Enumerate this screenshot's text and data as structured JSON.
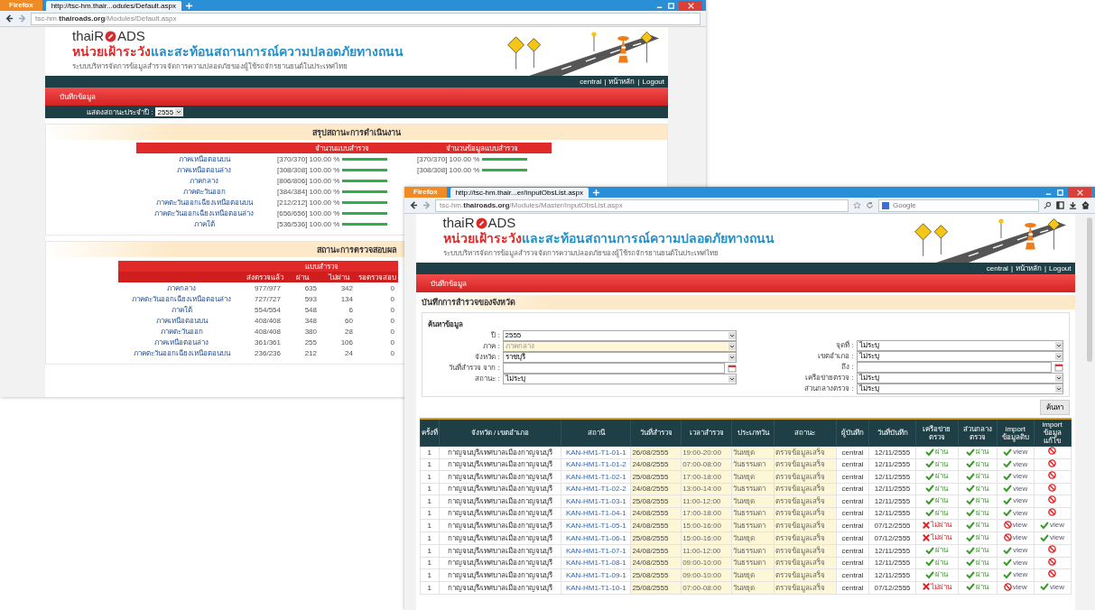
{
  "back_window": {
    "browser": {
      "menu_button": "Firefox",
      "tab": "http://tsc-hm.thair...odules/Default.aspx",
      "url": "tsc-hm.**thairoads.org**/Modules/Default.aspx"
    },
    "site": {
      "logo_lead": "thaiR",
      "logo_tail": "ADS",
      "title_lead": "หน่วยเฝ้าระวัง",
      "title_rest": "และสะท้อนสถานการณ์ความปลอดภัยทางถนน",
      "subtitle": "ระบบบริหารจัดการข้อมูลสำรวจจัดการความปลอดภัยของผู้ใช้รถจักรยานยนต์ในประเทศไทย",
      "user_links": [
        "central",
        "หน้าหลัก",
        "Logout"
      ],
      "link_separator": "|",
      "menu": "บันทึกข้อมูล"
    },
    "year_filter": {
      "label": "แสดงสถานะประจำปี :",
      "value": "2555"
    },
    "summary": {
      "title": "สรุปสถานะการดำเนินงาน",
      "columns": [
        "จำนวนแบบสำรวจ",
        "จำนวนข้อมูลแบบสำรวจ"
      ],
      "rows": [
        {
          "region": "ภาคเหนือตอนบน",
          "surveys": {
            "text": "[370/370] 100.00 %",
            "level": 1
          },
          "data": {
            "text": "[370/370] 100.00 %",
            "level": 1
          }
        },
        {
          "region": "ภาคเหนือตอนล่าง",
          "surveys": {
            "text": "[308/308] 100.00 %",
            "level": 1
          },
          "data": {
            "text": "[308/308] 100.00 %",
            "level": 1
          }
        },
        {
          "region": "ภาคกลาง",
          "surveys": {
            "text": "[806/806] 100.00 %",
            "level": 1
          }
        },
        {
          "region": "ภาคตะวันออก",
          "surveys": {
            "text": "[384/384] 100.00 %",
            "level": 1
          }
        },
        {
          "region": "ภาคตะวันออกเฉียงเหนือตอนบน",
          "surveys": {
            "text": "[212/212] 100.00 %",
            "level": 1
          }
        },
        {
          "region": "ภาคตะวันออกเฉียงเหนือตอนล่าง",
          "surveys": {
            "text": "[656/656] 100.00 %",
            "level": 1
          }
        },
        {
          "region": "ภาคใต้",
          "surveys": {
            "text": "[536/536] 100.00 %",
            "level": 1
          }
        }
      ]
    },
    "status": {
      "title": "สถานะการตรวจสอบผล",
      "group": "แบบสำรวจ",
      "columns": [
        "ส่งตรวจแล้ว",
        "ผ่าน",
        "ไม่ผ่าน",
        "รอตรวจสอบ"
      ],
      "rows": [
        {
          "region": "ภาคกลาง",
          "cells": [
            "977/977",
            "635",
            "342",
            "0"
          ]
        },
        {
          "region": "ภาคตะวันออกเฉียงเหนือตอนล่าง",
          "cells": [
            "727/727",
            "593",
            "134",
            "0"
          ]
        },
        {
          "region": "ภาคใต้",
          "cells": [
            "554/554",
            "548",
            "6",
            "0"
          ]
        },
        {
          "region": "ภาคเหนือตอนบน",
          "cells": [
            "408/408",
            "348",
            "60",
            "0"
          ]
        },
        {
          "region": "ภาคตะวันออก",
          "cells": [
            "408/408",
            "380",
            "28",
            "0"
          ]
        },
        {
          "region": "ภาคเหนือตอนล่าง",
          "cells": [
            "361/361",
            "255",
            "106",
            "0"
          ]
        },
        {
          "region": "ภาคตะวันออกเฉียงเหนือตอนบน",
          "cells": [
            "236/236",
            "212",
            "24",
            "0"
          ]
        }
      ]
    }
  },
  "front_window": {
    "browser": {
      "menu_button": "Firefox",
      "tab": "http://tsc-hm.thair...er/InputObsList.aspx",
      "url": "tsc-hm.**thairoads.org**/Modules/Master/InputObsList.aspx",
      "search": "Google"
    },
    "site": {
      "logo_lead": "thaiR",
      "logo_tail": "ADS",
      "title_lead": "หน่วยเฝ้าระวัง",
      "title_rest": "และสะท้อนสถานการณ์ความปลอดภัยทางถนน",
      "subtitle": "ระบบบริหารจัดการข้อมูลสำรวจจัดการความปลอดภัยของผู้ใช้รถจักรยานยนต์ในประเทศไทย",
      "user_links": [
        "central",
        "หน้าหลัก",
        "Logout"
      ],
      "link_separator": "|",
      "menu": "บันทึกข้อมูล"
    },
    "section_title": "บันทึกการสำรวจของจังหวัด",
    "search": {
      "legend": "ค้นหาข้อมูล",
      "button": "ค้นหา",
      "left": [
        {
          "kind": "select",
          "label": "ปี :",
          "value": "2555",
          "disabled": false
        },
        {
          "kind": "select",
          "label": "ภาค :",
          "value": "ภาคกลาง",
          "disabled": true
        },
        {
          "kind": "select",
          "label": "จังหวัด :",
          "value": "ราชบุรี",
          "disabled": false
        },
        {
          "kind": "date",
          "label": "วันที่สำรวจ จาก :",
          "disabled": false
        },
        {
          "kind": "select",
          "label": "สถานะ :",
          "value": "ไม่ระบุ",
          "disabled": false
        }
      ],
      "right": [
        {
          "kind": "select",
          "label": "จุดที่ :",
          "value": "ไม่ระบุ",
          "disabled": false
        },
        {
          "kind": "select",
          "label": "เขตอำเภอ :",
          "value": "ไม่ระบุ",
          "disabled": false
        },
        {
          "kind": "date",
          "label": "ถึง :",
          "disabled": false
        },
        {
          "kind": "select",
          "label": "เครือข่ายตรวจ :",
          "value": "ไม่ระบุ",
          "disabled": false
        },
        {
          "kind": "select",
          "label": "ส่วนกลางตรวจ :",
          "value": "ไม่ระบุ",
          "disabled": false
        }
      ]
    },
    "table": {
      "columns": [
        "ครั้งที่",
        "จังหวัด / เขตอำเภอ",
        "สถานี",
        "วันที่สำรวจ",
        "เวลาสำรวจ",
        "ประเภทวัน",
        "สถานะ",
        "ผู้บันทึก",
        "วันที่บันทึก",
        "เครือข่ายตรวจ",
        "ส่วนกลางตรวจ",
        "import ข้อมูลดิบ",
        "import ข้อมูลแก้ไข"
      ],
      "rows": [
        {
          "no": "1",
          "district": "กาญจนบุรี/เทศบาลเมืองกาญจนบุรี",
          "station": "KAN-HM1-T1-01-1",
          "date": "26/08/2555",
          "time": "19:00-20:00",
          "day_type": "วันหยุด",
          "status": "ตรวจข้อมูลเสร็จ",
          "recorder": "central",
          "recorded": "12/11/2555",
          "network": {
            "pass": true,
            "label": "ผ่าน"
          },
          "central": {
            "pass": true,
            "label": "ผ่าน"
          },
          "import_raw": {
            "available": true,
            "label": "view"
          },
          "import_edit": {
            "available": false
          }
        },
        {
          "no": "1",
          "district": "กาญจนบุรี/เทศบาลเมืองกาญจนบุรี",
          "station": "KAN-HM1-T1-01-2",
          "date": "24/08/2555",
          "time": "07:00-08:00",
          "day_type": "วันธรรมดา",
          "status": "ตรวจข้อมูลเสร็จ",
          "recorder": "central",
          "recorded": "12/11/2555",
          "network": {
            "pass": true,
            "label": "ผ่าน"
          },
          "central": {
            "pass": true,
            "label": "ผ่าน"
          },
          "import_raw": {
            "available": true,
            "label": "view"
          },
          "import_edit": {
            "available": false
          }
        },
        {
          "no": "1",
          "district": "กาญจนบุรี/เทศบาลเมืองกาญจนบุรี",
          "station": "KAN-HM1-T1-02-1",
          "date": "25/08/2555",
          "time": "17:00-18:00",
          "day_type": "วันหยุด",
          "status": "ตรวจข้อมูลเสร็จ",
          "recorder": "central",
          "recorded": "12/11/2555",
          "network": {
            "pass": true,
            "label": "ผ่าน"
          },
          "central": {
            "pass": true,
            "label": "ผ่าน"
          },
          "import_raw": {
            "available": true,
            "label": "view"
          },
          "import_edit": {
            "available": false
          }
        },
        {
          "no": "1",
          "district": "กาญจนบุรี/เทศบาลเมืองกาญจนบุรี",
          "station": "KAN-HM1-T1-02-2",
          "date": "24/08/2555",
          "time": "13:00-14:00",
          "day_type": "วันธรรมดา",
          "status": "ตรวจข้อมูลเสร็จ",
          "recorder": "central",
          "recorded": "12/11/2555",
          "network": {
            "pass": true,
            "label": "ผ่าน"
          },
          "central": {
            "pass": true,
            "label": "ผ่าน"
          },
          "import_raw": {
            "available": true,
            "label": "view"
          },
          "import_edit": {
            "available": false
          }
        },
        {
          "no": "1",
          "district": "กาญจนบุรี/เทศบาลเมืองกาญจนบุรี",
          "station": "KAN-HM1-T1-03-1",
          "date": "25/08/2555",
          "time": "11:00-12:00",
          "day_type": "วันหยุด",
          "status": "ตรวจข้อมูลเสร็จ",
          "recorder": "central",
          "recorded": "12/11/2555",
          "network": {
            "pass": true,
            "label": "ผ่าน"
          },
          "central": {
            "pass": true,
            "label": "ผ่าน"
          },
          "import_raw": {
            "available": true,
            "label": "view"
          },
          "import_edit": {
            "available": false
          }
        },
        {
          "no": "1",
          "district": "กาญจนบุรี/เทศบาลเมืองกาญจนบุรี",
          "station": "KAN-HM1-T1-04-1",
          "date": "24/08/2555",
          "time": "17:00-18:00",
          "day_type": "วันธรรมดา",
          "status": "ตรวจข้อมูลเสร็จ",
          "recorder": "central",
          "recorded": "12/11/2555",
          "network": {
            "pass": true,
            "label": "ผ่าน"
          },
          "central": {
            "pass": true,
            "label": "ผ่าน"
          },
          "import_raw": {
            "available": true,
            "label": "view"
          },
          "import_edit": {
            "available": false
          }
        },
        {
          "no": "1",
          "district": "กาญจนบุรี/เทศบาลเมืองกาญจนบุรี",
          "station": "KAN-HM1-T1-05-1",
          "date": "24/08/2555",
          "time": "15:00-16:00",
          "day_type": "วันธรรมดา",
          "status": "ตรวจข้อมูลเสร็จ",
          "recorder": "central",
          "recorded": "07/12/2555",
          "network": {
            "pass": false,
            "label": "ไม่ผ่าน"
          },
          "central": {
            "pass": true,
            "label": "ผ่าน"
          },
          "import_raw": {
            "available": false,
            "label": "view"
          },
          "import_edit": {
            "available": true,
            "label": "view"
          }
        },
        {
          "no": "1",
          "district": "กาญจนบุรี/เทศบาลเมืองกาญจนบุรี",
          "station": "KAN-HM1-T1-06-1",
          "date": "25/08/2555",
          "time": "15:00-16:00",
          "day_type": "วันหยุด",
          "status": "ตรวจข้อมูลเสร็จ",
          "recorder": "central",
          "recorded": "07/12/2555",
          "network": {
            "pass": false,
            "label": "ไม่ผ่าน"
          },
          "central": {
            "pass": true,
            "label": "ผ่าน"
          },
          "import_raw": {
            "available": false,
            "label": "view"
          },
          "import_edit": {
            "available": true,
            "label": "view"
          }
        },
        {
          "no": "1",
          "district": "กาญจนบุรี/เทศบาลเมืองกาญจนบุรี",
          "station": "KAN-HM1-T1-07-1",
          "date": "24/08/2555",
          "time": "11:00-12:00",
          "day_type": "วันธรรมดา",
          "status": "ตรวจข้อมูลเสร็จ",
          "recorder": "central",
          "recorded": "12/11/2555",
          "network": {
            "pass": true,
            "label": "ผ่าน"
          },
          "central": {
            "pass": true,
            "label": "ผ่าน"
          },
          "import_raw": {
            "available": true,
            "label": "view"
          },
          "import_edit": {
            "available": false
          }
        },
        {
          "no": "1",
          "district": "กาญจนบุรี/เทศบาลเมืองกาญจนบุรี",
          "station": "KAN-HM1-T1-08-1",
          "date": "24/08/2555",
          "time": "09:00-10:00",
          "day_type": "วันธรรมดา",
          "status": "ตรวจข้อมูลเสร็จ",
          "recorder": "central",
          "recorded": "12/11/2555",
          "network": {
            "pass": true,
            "label": "ผ่าน"
          },
          "central": {
            "pass": true,
            "label": "ผ่าน"
          },
          "import_raw": {
            "available": true,
            "label": "view"
          },
          "import_edit": {
            "available": false
          }
        },
        {
          "no": "1",
          "district": "กาญจนบุรี/เทศบาลเมืองกาญจนบุรี",
          "station": "KAN-HM1-T1-09-1",
          "date": "25/08/2555",
          "time": "09:00-10:00",
          "day_type": "วันหยุด",
          "status": "ตรวจข้อมูลเสร็จ",
          "recorder": "central",
          "recorded": "12/11/2555",
          "network": {
            "pass": true,
            "label": "ผ่าน"
          },
          "central": {
            "pass": true,
            "label": "ผ่าน"
          },
          "import_raw": {
            "available": true,
            "label": "view"
          },
          "import_edit": {
            "available": false
          }
        },
        {
          "no": "1",
          "district": "กาญจนบุรี/เทศบาลเมืองกาญจนบุรี",
          "station": "KAN-HM1-T1-10-1",
          "date": "25/08/2555",
          "time": "07:00-08:00",
          "day_type": "วันหยุด",
          "status": "ตรวจข้อมูลเสร็จ",
          "recorder": "central",
          "recorded": "07/12/2555",
          "network": {
            "pass": false,
            "label": "ไม่ผ่าน"
          },
          "central": {
            "pass": true,
            "label": "ผ่าน"
          },
          "import_raw": {
            "available": false,
            "label": "view"
          },
          "import_edit": {
            "available": true,
            "label": "view"
          }
        }
      ]
    }
  }
}
